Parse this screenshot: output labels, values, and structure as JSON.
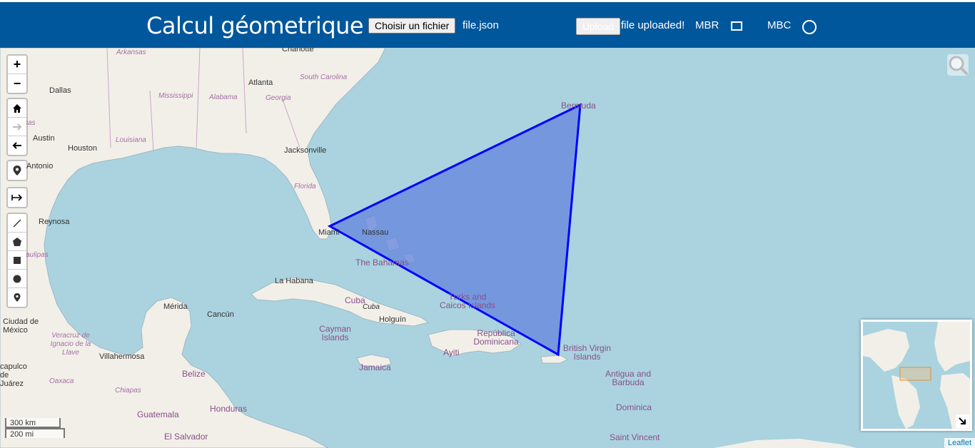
{
  "header": {
    "title": "Calcul géometrique",
    "choose_file_label": "Choisir un fichier",
    "file_name": "file.json",
    "upload_label": "Upload",
    "status": "file uploaded!",
    "mbr_label": "MBR",
    "mbc_label": "MBC"
  },
  "map": {
    "labels": {
      "arkansas": "Arkansas",
      "charlotte": "Charlotte",
      "dallas": "Dallas",
      "mississippi": "Mississippi",
      "alabama": "Alabama",
      "atlanta": "Atlanta",
      "georgia": "Georgia",
      "south_carolina": "South Carolina",
      "louisiana": "Louisiana",
      "austin": "Austin",
      "houston": "Houston",
      "jacksonville": "Jacksonville",
      "antonio": "Antonio",
      "florida": "Florida",
      "reynosa": "Reynosa",
      "miami": "Miami",
      "nassau": "Nassau",
      "the_bahamas": "The Bahamas",
      "bermuda": "Bermuda",
      "la_habana": "La Habana",
      "cuba": "Cuba",
      "cuba_small": "Cuba",
      "holguin": "Holguín",
      "turks": "Turks and Caicos Islands",
      "merida": "Mérida",
      "cancun": "Cancún",
      "ciudad_mexico": "Ciudad de México",
      "veracruz": "Veracruz de Ignacio de la Llave",
      "cayman": "Cayman Islands",
      "republica": "República Dominicana",
      "ayiti": "Ayiti",
      "bvi": "British Virgin Islands",
      "jamaica": "Jamaica",
      "villahermosa": "Villahermosa",
      "capulco": "capulco de Juárez",
      "oaxaca": "Oaxaca",
      "belize": "Belize",
      "chiapas": "Chiapas",
      "guatemala": "Guatemala",
      "honduras": "Honduras",
      "el_salvador": "El Salvador",
      "antigua": "Antigua and Barbuda",
      "dominica": "Dominica",
      "saint_vincent": "Saint Vincent",
      "tamaulipas": "aulipas",
      "cas": "cas"
    },
    "scale": {
      "metric": "300 km",
      "imperial": "200 mi"
    },
    "attribution": "Leaflet",
    "polygon_color": "#0000ff",
    "polygon_fill": "#6688dd"
  },
  "controls": {
    "zoom_in": "+",
    "zoom_out": "−"
  }
}
